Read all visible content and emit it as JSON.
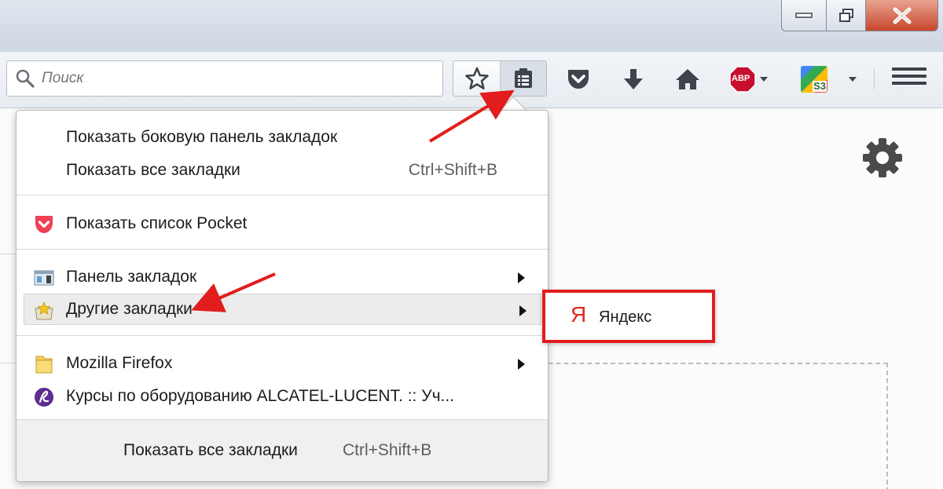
{
  "toolbar": {
    "search_placeholder": "Поиск",
    "abp_label": "ABP",
    "s3_label": "S3"
  },
  "bookmarks_menu": {
    "show_sidebar": "Показать боковую панель закладок",
    "show_all": "Показать все закладки",
    "show_all_shortcut": "Ctrl+Shift+B",
    "show_pocket": "Показать список Pocket",
    "bookmarks_toolbar": "Панель закладок",
    "other_bookmarks": "Другие закладки",
    "mozilla_firefox": "Mozilla Firefox",
    "alcatel": "Курсы по оборудованию ALCATEL-LUCENT. :: Уч...",
    "footer_show_all": "Показать все закладки",
    "footer_shortcut": "Ctrl+Shift+B"
  },
  "other_bookmarks_submenu": {
    "logo": "Я",
    "label": "Яндекс"
  },
  "colors": {
    "annotation_red": "#e21d1d",
    "pocket_red": "#ef4056",
    "abp_red": "#c8102e",
    "alcatel_purple": "#5b2d90"
  }
}
